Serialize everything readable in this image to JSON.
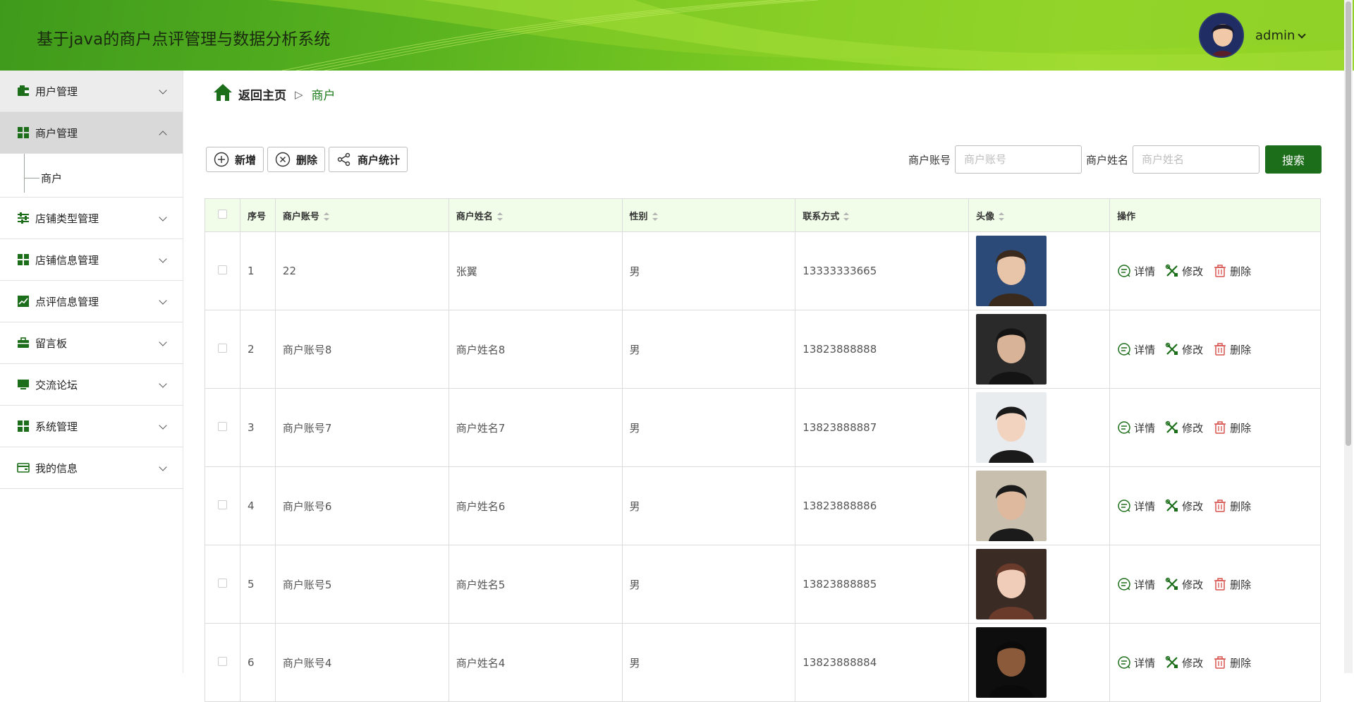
{
  "header": {
    "title": "基于java的商户点评管理与数据分析系统",
    "username": "admin"
  },
  "sidebar": {
    "items": [
      {
        "label": "用户管理",
        "icon": "wallet-icon"
      },
      {
        "label": "商户管理",
        "icon": "grid-icon"
      },
      {
        "label": "店铺类型管理",
        "icon": "sliders-icon"
      },
      {
        "label": "店铺信息管理",
        "icon": "grid-icon"
      },
      {
        "label": "点评信息管理",
        "icon": "chart-icon"
      },
      {
        "label": "留言板",
        "icon": "briefcase-icon"
      },
      {
        "label": "交流论坛",
        "icon": "monitor-icon"
      },
      {
        "label": "系统管理",
        "icon": "grid-icon"
      },
      {
        "label": "我的信息",
        "icon": "card-icon"
      }
    ],
    "sub_item": "商户"
  },
  "breadcrumb": {
    "home": "返回主页",
    "separator": "▷",
    "current": "商户"
  },
  "toolbar": {
    "add": "新增",
    "delete": "删除",
    "stats": "商户统计"
  },
  "search": {
    "account_label": "商户账号",
    "account_placeholder": "商户账号",
    "name_label": "商户姓名",
    "name_placeholder": "商户姓名",
    "button": "搜索"
  },
  "table": {
    "headers": [
      "序号",
      "商户账号",
      "商户姓名",
      "性别",
      "联系方式",
      "头像",
      "操作"
    ],
    "rows": [
      {
        "no": "1",
        "account": "22",
        "name": "张翼",
        "gender": "男",
        "phone": "13333333665"
      },
      {
        "no": "2",
        "account": "商户账号8",
        "name": "商户姓名8",
        "gender": "男",
        "phone": "13823888888"
      },
      {
        "no": "3",
        "account": "商户账号7",
        "name": "商户姓名7",
        "gender": "男",
        "phone": "13823888887"
      },
      {
        "no": "4",
        "account": "商户账号6",
        "name": "商户姓名6",
        "gender": "男",
        "phone": "13823888886"
      },
      {
        "no": "5",
        "account": "商户账号5",
        "name": "商户姓名5",
        "gender": "男",
        "phone": "13823888885"
      },
      {
        "no": "6",
        "account": "商户账号4",
        "name": "商户姓名4",
        "gender": "男",
        "phone": "13823888884"
      }
    ],
    "actions": {
      "detail": "详情",
      "edit": "修改",
      "delete": "删除"
    }
  },
  "colors": {
    "brand_green": "#1d6e1a",
    "header_start": "#3f9a1c",
    "header_end": "#98d829",
    "table_header_bg": "#f1fde9",
    "delete_red": "#d9534f"
  }
}
